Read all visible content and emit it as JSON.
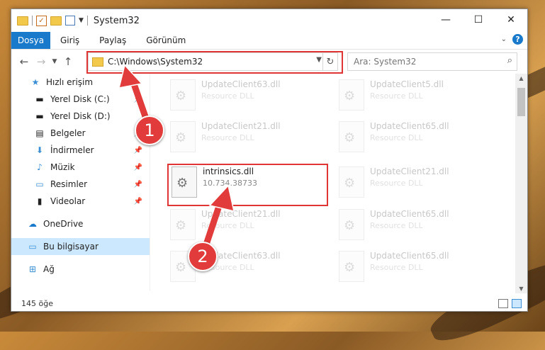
{
  "window": {
    "title": "System32"
  },
  "window_controls": {
    "minimize": "—",
    "maximize": "☐",
    "close": "✕"
  },
  "ribbon": {
    "file_tab": "Dosya",
    "tabs": [
      "Giriş",
      "Paylaş",
      "Görünüm"
    ]
  },
  "address": {
    "path": "C:\\Windows\\System32"
  },
  "search": {
    "placeholder": "Ara: System32"
  },
  "nav": {
    "items": [
      {
        "label": "Hızlı erişim",
        "icon": "star-icon"
      },
      {
        "label": "Yerel Disk (C:)",
        "icon": "drive-icon"
      },
      {
        "label": "Yerel Disk (D:)",
        "icon": "drive-icon"
      },
      {
        "label": "Belgeler",
        "icon": "documents-icon"
      },
      {
        "label": "İndirmeler",
        "icon": "downloads-icon"
      },
      {
        "label": "Müzik",
        "icon": "music-icon"
      },
      {
        "label": "Resimler",
        "icon": "pictures-icon"
      },
      {
        "label": "Videolar",
        "icon": "videos-icon"
      },
      {
        "label": "OneDrive",
        "icon": "cloud-icon"
      },
      {
        "label": "Bu bilgisayar",
        "icon": "computer-icon"
      },
      {
        "label": "Ağ",
        "icon": "network-icon"
      }
    ]
  },
  "files": [
    {
      "name": "UpdateClient63.dll",
      "desc": "Resource DLL"
    },
    {
      "name": "UpdateClient5.dll",
      "desc": "Resource DLL"
    },
    {
      "name": "UpdateClient21.dll",
      "desc": "Resource DLL"
    },
    {
      "name": "UpdateClient65.dll",
      "desc": "Resource DLL"
    },
    {
      "name": "intrinsics.dll",
      "desc": "10.734.38733"
    },
    {
      "name": "UpdateClient21.dll",
      "desc": "Resource DLL"
    },
    {
      "name": "UpdateClient21.dll",
      "desc": "Resource DLL"
    },
    {
      "name": "UpdateClient65.dll",
      "desc": "Resource DLL"
    },
    {
      "name": "UpdateClient63.dll",
      "desc": "Resource DLL"
    },
    {
      "name": "UpdateClient65.dll",
      "desc": "Resource DLL"
    }
  ],
  "status": {
    "count": "145 öğe"
  },
  "callouts": {
    "one": "1",
    "two": "2"
  },
  "colors": {
    "accent": "#1979ca",
    "highlight": "#e03535",
    "selected": "#cce8ff"
  }
}
